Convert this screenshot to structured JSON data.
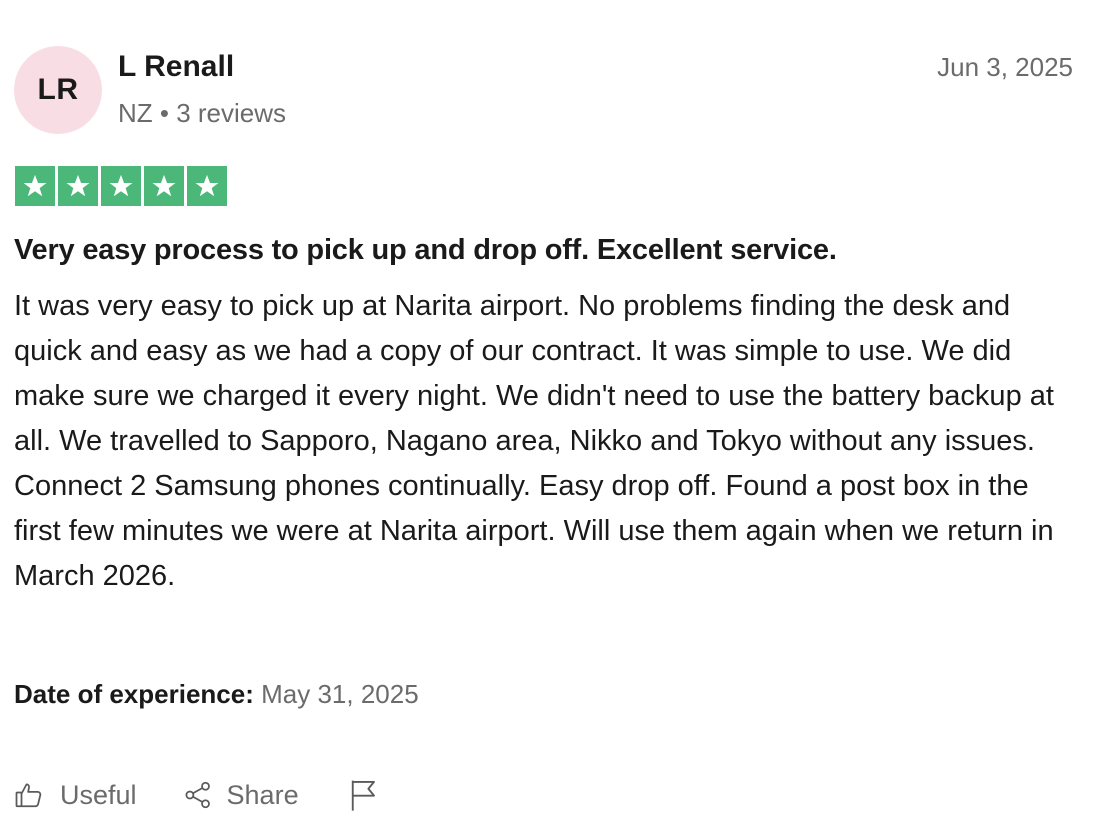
{
  "consumer": {
    "initials": "LR",
    "name": "L Renall",
    "meta": "NZ • 3 reviews",
    "avatar_color": "#f9dde4"
  },
  "review": {
    "date": "Jun 3, 2025",
    "rating": 5,
    "rating_max": 5,
    "star_color": "#4bb87a",
    "title": "Very easy process to pick up and drop off. Excellent service.",
    "body": "It was very easy to pick up at Narita airport. No problems finding the desk and quick and easy as we had a copy of our contract. It was simple to use. We did make sure we charged it every night. We didn't need to use the battery backup at all. We travelled to Sapporo, Nagano area, Nikko and Tokyo without any issues. Connect 2 Samsung phones continually. Easy drop off. Found a post box in the first few minutes we were at Narita airport. Will use them again when we return in March 2026.",
    "experience_label": "Date of experience:",
    "experience_date": "May 31, 2025"
  },
  "actions": {
    "useful_label": "Useful",
    "useful_icon": "thumbs-up-icon",
    "share_label": "Share",
    "share_icon": "share-icon",
    "flag_icon": "flag-icon"
  }
}
